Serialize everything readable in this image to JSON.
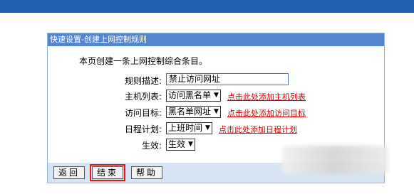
{
  "panel": {
    "title": "快速设置-创建上网控制规则",
    "intro": "本页创建一条上网控制综合条目。"
  },
  "form": {
    "desc_label": "规则描述:",
    "desc_value": "禁止访问网址",
    "host_label": "主机列表:",
    "host_value": "访问黑名单",
    "host_link": "点击此处添加主机列表",
    "target_label": "访问目标:",
    "target_value": "黑名单网址",
    "target_link": "点击此处添加访问目标",
    "schedule_label": "日程计划:",
    "schedule_value": "上班时间",
    "schedule_link": "点击此处添加日程计划",
    "effect_label": "生效:",
    "effect_value": "生效"
  },
  "buttons": {
    "back": "返回",
    "finish": "结束",
    "help": "帮助"
  },
  "colors": {
    "header": "#5486cf",
    "top_bar": "#1e5fb0",
    "link": "#d40000",
    "highlight": "#e01a1a"
  }
}
